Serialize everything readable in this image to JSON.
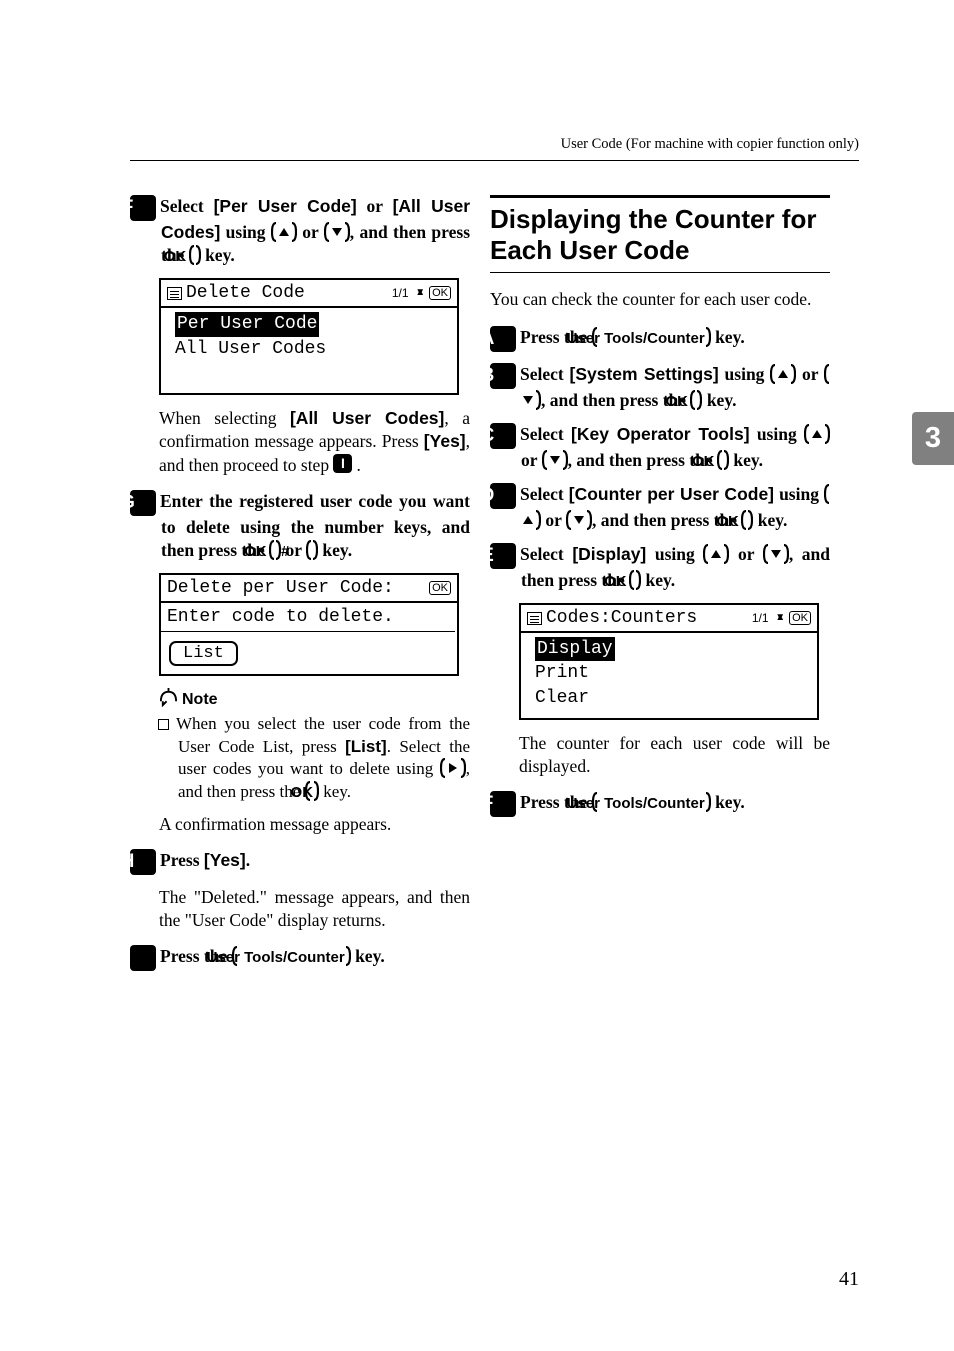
{
  "header": "User Code (For machine with copier function only)",
  "left": {
    "step6": {
      "label": "F",
      "text_a": "Select ",
      "opt1": "[Per User Code]",
      "text_b": " or ",
      "opt2": "[All User Codes]",
      "text_c": " using ",
      "text_d": " or ",
      "text_e": ", and then press the ",
      "ok": "OK",
      "text_f": " key."
    },
    "lcd1": {
      "title": "Delete Code",
      "page": "1/1",
      "row1": "Per User Code",
      "row2": "All User Codes"
    },
    "after_lcd1_a": "When selecting ",
    "after_lcd1_opt": "[All User Codes]",
    "after_lcd1_b": ", a confirmation message appears. Press ",
    "after_lcd1_yes": "[Yes]",
    "after_lcd1_c": ", and then proceed to step ",
    "after_lcd1_step": "I",
    "after_lcd1_d": ".",
    "step7": {
      "label": "G",
      "text_a": "Enter the registered user code you want to delete using the number keys, and then press the ",
      "ok": "OK",
      "text_b": " or ",
      "hash": "#",
      "text_c": " key."
    },
    "lcd2": {
      "title": "Delete per User Code:",
      "row1": "Enter code to delete.",
      "button": "List"
    },
    "note_label": "Note",
    "note_bullet_a": "When you select the user code from the User Code List, press ",
    "note_list": "[List]",
    "note_bullet_b": ". Select the user codes you want to delete using ",
    "note_bullet_c": ", and then press the ",
    "note_ok": "OK",
    "note_bullet_d": " key.",
    "confirm_line": "A confirmation message appears.",
    "step8": {
      "label": "H",
      "text_a": "Press ",
      "yes": "[Yes]",
      "text_b": "."
    },
    "deleted_line": "The \"Deleted.\" message appears, and then the \"User Code\" display returns.",
    "step9": {
      "label": "I",
      "text_a": "Press the ",
      "utc": "User Tools/Counter",
      "text_b": " key."
    }
  },
  "right": {
    "heading": "Displaying the Counter for Each User Code",
    "intro": "You can check the counter for each user code.",
    "step1": {
      "label": "A",
      "a": "Press the ",
      "utc": "User Tools/Counter",
      "b": " key."
    },
    "step2": {
      "label": "B",
      "a": "Select ",
      "opt": "[System Settings]",
      "b": " using ",
      "c": " or ",
      "d": ", and then press the ",
      "ok": "OK",
      "e": " key."
    },
    "step3": {
      "label": "C",
      "a": "Select ",
      "opt": "[Key Operator Tools]",
      "b": " using ",
      "c": " or ",
      "d": ", and then press the ",
      "ok": "OK",
      "e": " key."
    },
    "step4": {
      "label": "D",
      "a": "Select ",
      "opt": "[Counter per User Code]",
      "b": " using ",
      "c": " or ",
      "d": ", and then press the ",
      "ok": "OK",
      "e": " key."
    },
    "step5": {
      "label": "E",
      "a": "Select ",
      "opt": "[Display]",
      "b": " using ",
      "c": " or ",
      "d": ", and then press the ",
      "ok": "OK",
      "e": " key."
    },
    "lcd": {
      "title": "Codes:Counters",
      "page": "1/1",
      "row1": "Display",
      "row2": "Print",
      "row3": "Clear"
    },
    "after": "The counter for each user code will be displayed.",
    "step6": {
      "label": "F",
      "a": "Press the ",
      "utc": "User Tools/Counter",
      "b": " key."
    }
  },
  "sidetab": "3",
  "page_num": "41",
  "ok_small": "OK",
  "dashes": "________"
}
